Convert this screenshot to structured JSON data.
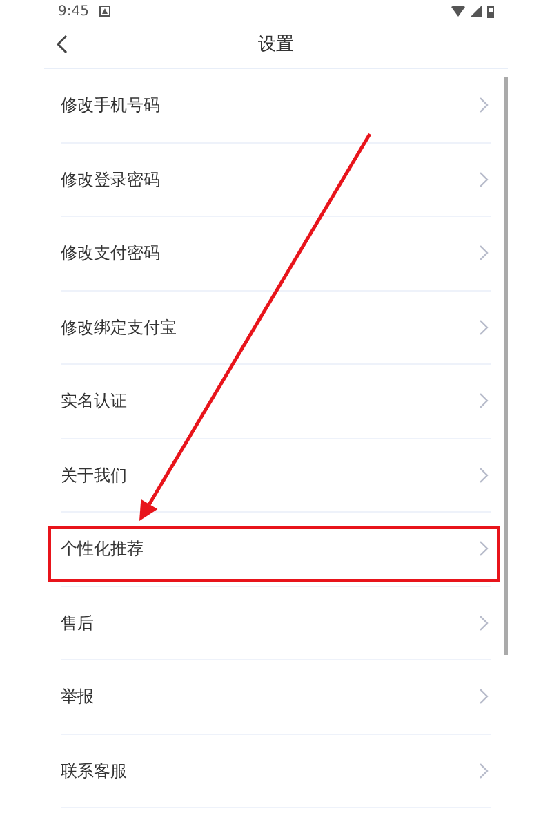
{
  "status_bar": {
    "time": "9:45"
  },
  "header": {
    "title": "设置"
  },
  "items": [
    {
      "label": "修改手机号码",
      "highlighted": false
    },
    {
      "label": "修改登录密码",
      "highlighted": false
    },
    {
      "label": "修改支付密码",
      "highlighted": false
    },
    {
      "label": "修改绑定支付宝",
      "highlighted": false
    },
    {
      "label": "实名认证",
      "highlighted": false
    },
    {
      "label": "关于我们",
      "highlighted": false
    },
    {
      "label": "个性化推荐",
      "highlighted": true
    },
    {
      "label": "售后",
      "highlighted": false
    },
    {
      "label": "举报",
      "highlighted": false
    },
    {
      "label": "联系客服",
      "highlighted": false
    }
  ]
}
